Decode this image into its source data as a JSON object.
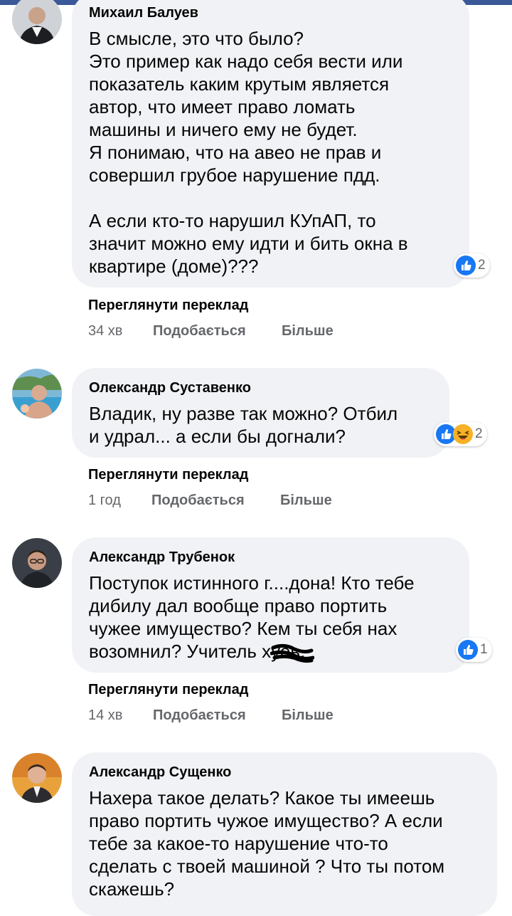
{
  "comments": [
    {
      "author": "Михаил Балуев",
      "text": "В смысле, это что было?\nЭто пример как надо себя вести или\nпоказатель каким крутым является\nавтор, что имеет право ломать\nмашины и ничего ему не будет.\nЯ понимаю, что на авео не прав и\nсовершил грубое нарушение пдд.\n\nА если кто-то нарушил КУпАП, то\nзначит можно ему идти и бить окна в\nквартире (доме)???",
      "reaction_count": "2",
      "reactions": [
        "like-icon"
      ],
      "translate": "Переглянути переклад",
      "time": "34 хв",
      "like": "Подобається",
      "more": "Більше"
    },
    {
      "author": "Олександр Суставенко",
      "text": "Владик, ну разве так можно? Отбил\nи удрал... а если бы догнали?",
      "reaction_count": "2",
      "reactions": [
        "like-icon",
        "haha-icon"
      ],
      "translate": "Переглянути переклад",
      "time": "1 год",
      "like": "Подобається",
      "more": "Більше"
    },
    {
      "author": "Александр Трубенок",
      "text": "Поступок истинного г....дона! Кто тебе\nдибилу дал вообще право портить\nчужее имущество? Кем ты себя нах\nвозомнил? Учитель хуев.",
      "reaction_count": "1",
      "reactions": [
        "like-icon"
      ],
      "translate": "Переглянути переклад",
      "time": "14 хв",
      "like": "Подобається",
      "more": "Більше"
    },
    {
      "author": "Александр Сущенко",
      "text": "Нахера такое делать? Какое ты имеешь\nправо портить чужое имущество? А если\nтебе за какое-то нарушение что-то\nсделать с твоей машиной ? Что ты потом\nскажешь?"
    }
  ],
  "colors": {
    "bubble": "#f0f2f5",
    "like_blue": "#1877f2",
    "haha_yellow": "#f7b125",
    "meta_gray": "#65676b",
    "top_bar": "#3b5998"
  }
}
